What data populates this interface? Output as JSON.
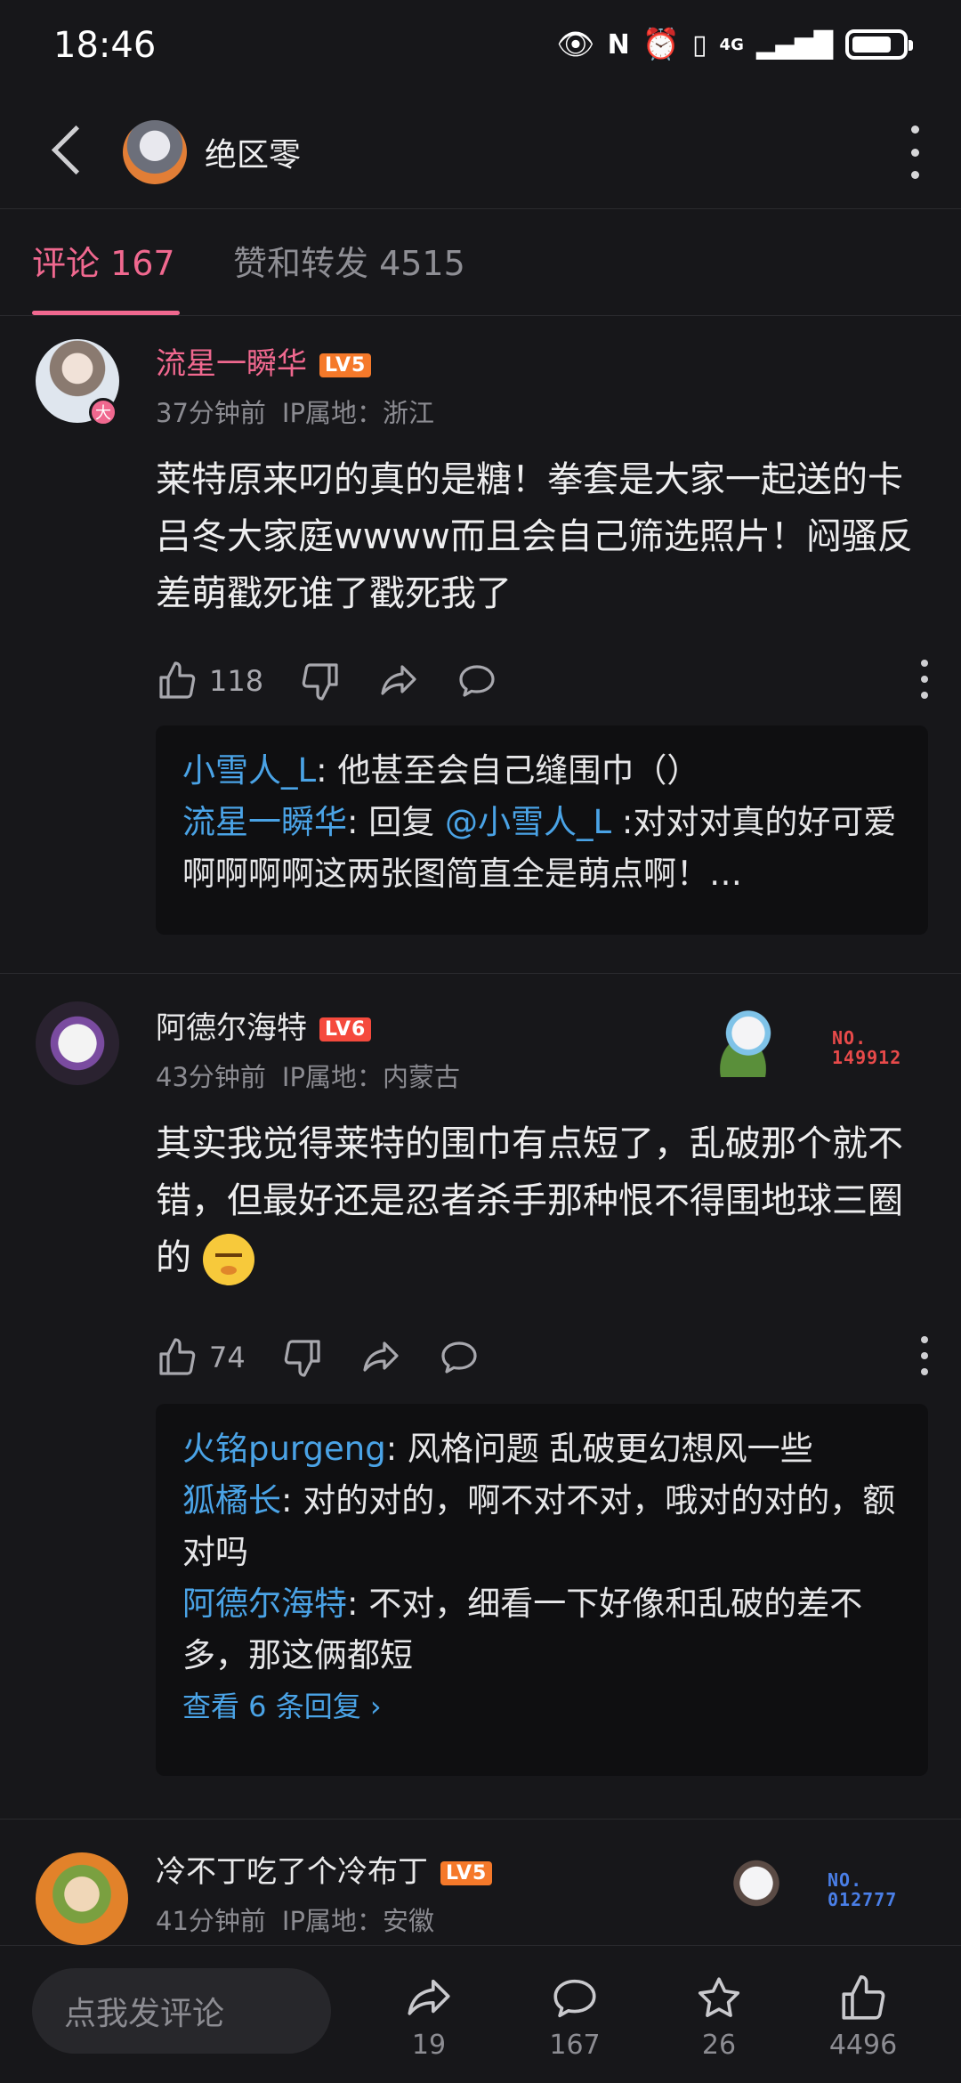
{
  "status": {
    "time": "18:46",
    "network": "4G",
    "battery_level": 0.7
  },
  "header": {
    "title": "绝区零"
  },
  "tabs": {
    "comments": "评论 167",
    "likes": "赞和转发 4515"
  },
  "comments": [
    {
      "user": "流星一瞬华",
      "level": "LV5",
      "badge": "大",
      "time": "37分钟前",
      "ip": "IP属地：浙江",
      "text": "莱特原来叼的真的是糖！拳套是大家一起送的卡吕冬大家庭wwww而且会自己筛选照片！闷骚反差萌戳死谁了戳死我了",
      "likes": "118",
      "replies": [
        {
          "who": "小雪人_L",
          "text": ": 他甚至会自己缝围巾（）"
        },
        {
          "who": "流星一瞬华",
          "text": ": 回复 ",
          "mention": "@小雪人_L",
          "rest": " :对对对真的好可爱啊啊啊啊这两张图简直全是萌点啊！…"
        }
      ]
    },
    {
      "user": "阿德尔海特",
      "level": "LV6",
      "time": "43分钟前",
      "ip": "IP属地：内蒙古",
      "text": "其实我觉得莱特的围巾有点短了，乱破那个就不错，但最好还是忍者杀手那种恨不得围地球三圈的",
      "likes": "74",
      "no_badge": "NO.\n149912",
      "replies": [
        {
          "who": "火铭purgeng",
          "text": ": 风格问题 乱破更幻想风一些"
        },
        {
          "who": "狐橘长",
          "text": ": 对的对的，啊不对不对，哦对的对的，额对吗"
        },
        {
          "who": "阿德尔海特",
          "text": ": 不对，细看一下好像和乱破的差不多，那这俩都短"
        }
      ],
      "view_more": "查看 6 条回复 ›"
    },
    {
      "user": "冷不丁吃了个冷布丁",
      "level": "LV5",
      "time": "41分钟前",
      "ip": "IP属地：安徽",
      "no_badge": "NO.\n012777"
    }
  ],
  "bottom": {
    "placeholder": "点我发评论",
    "share_count": "19",
    "comment_count": "167",
    "favorite_count": "26",
    "like_count": "4496"
  },
  "colors": {
    "accent": "#f0688f",
    "link": "#4aa3e6",
    "background": "#17171a"
  }
}
